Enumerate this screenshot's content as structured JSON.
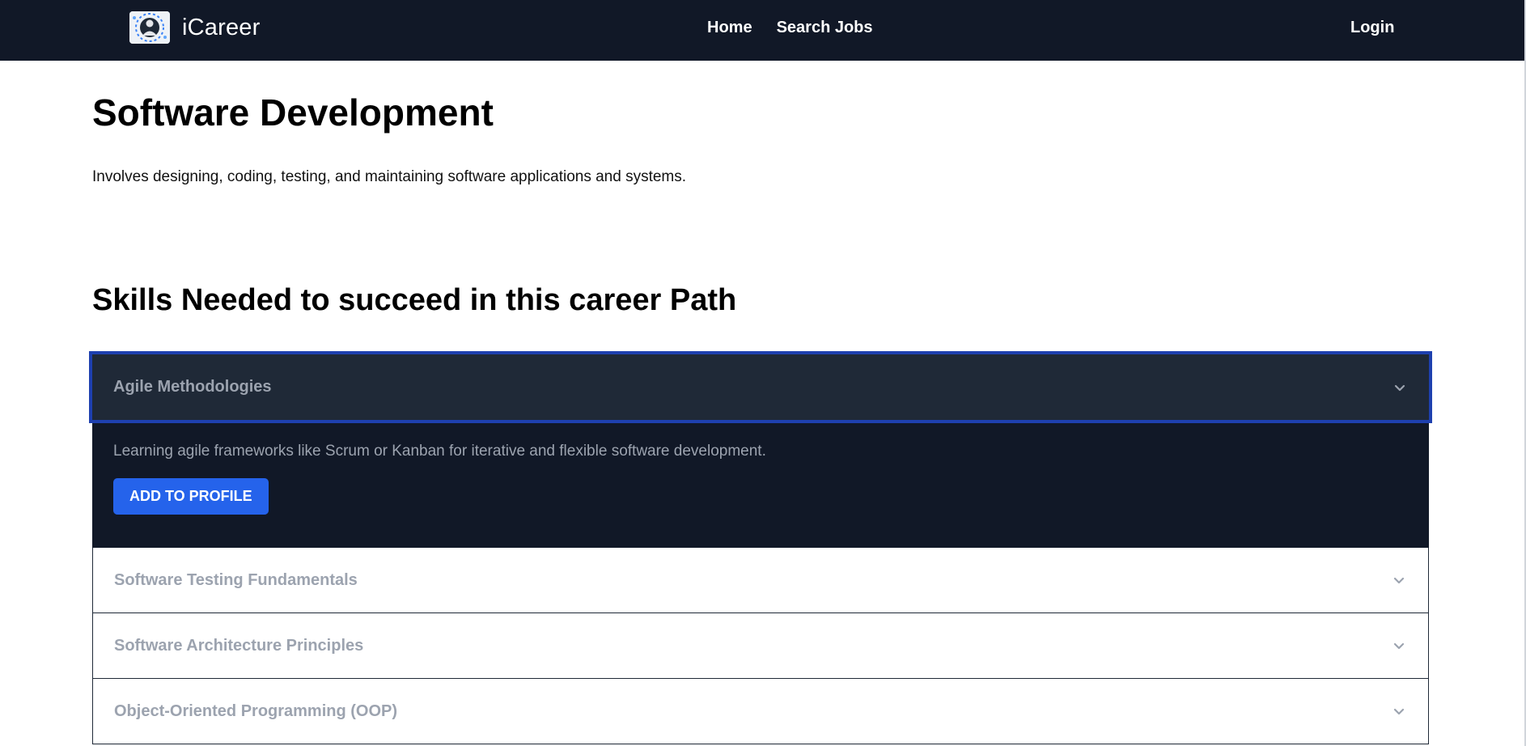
{
  "nav": {
    "brand": "iCareer",
    "links": [
      "Home",
      "Search Jobs"
    ],
    "login": "Login"
  },
  "page": {
    "title": "Software Development",
    "description": "Involves designing, coding, testing, and maintaining software applications and systems.",
    "skills_heading": "Skills Needed to succeed in this career Path"
  },
  "accordion": {
    "items": [
      {
        "title": "Agile Methodologies",
        "expanded": true,
        "body": "Learning agile frameworks like Scrum or Kanban for iterative and flexible software development.",
        "button": "ADD TO PROFILE"
      },
      {
        "title": "Software Testing Fundamentals",
        "expanded": false
      },
      {
        "title": "Software Architecture Principles",
        "expanded": false
      },
      {
        "title": "Object-Oriented Programming (OOP)",
        "expanded": false
      }
    ]
  },
  "colors": {
    "navbar_bg": "#111827",
    "accent_blue": "#2563eb",
    "focus_outline": "#1e40af",
    "open_header_bg": "#1f2937",
    "open_body_bg": "#111827",
    "muted_text": "#9ca3af"
  }
}
